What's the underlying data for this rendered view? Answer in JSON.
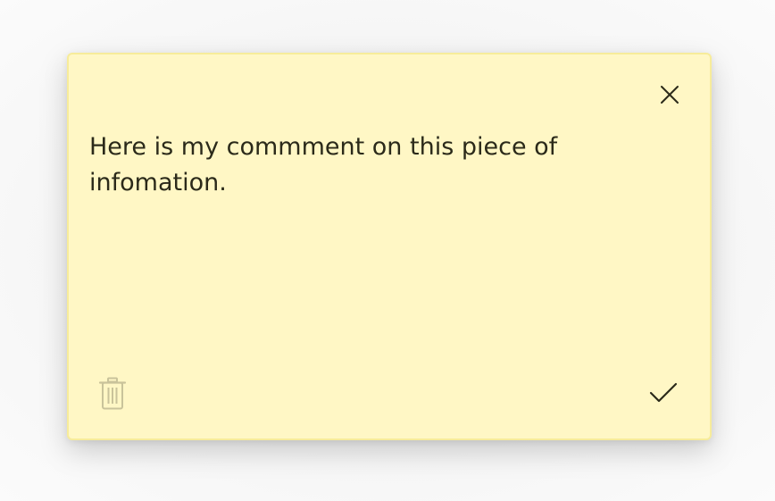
{
  "note": {
    "comment_text": "Here is my commment on this piece of infomation.",
    "background_color": "#fff7c5",
    "border_color": "#f7ec9a"
  },
  "icons": {
    "close": "close-icon",
    "delete": "trash-icon",
    "confirm": "checkmark-icon"
  },
  "colors": {
    "text": "#2b2a1a",
    "icon_dark": "#2b2a1a",
    "icon_disabled": "#c9c39a"
  }
}
